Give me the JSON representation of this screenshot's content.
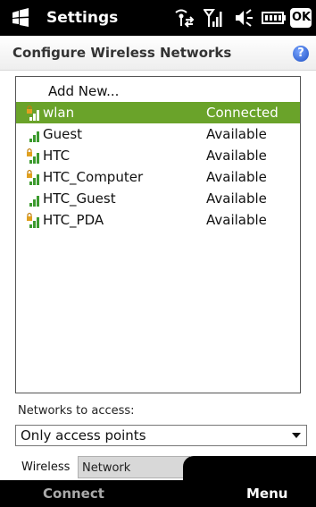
{
  "statusbar": {
    "title": "Settings",
    "ok_label": "OK",
    "icons": [
      "windows-flag-icon",
      "connectivity-icon",
      "signal-icon",
      "volume-icon",
      "battery-icon"
    ]
  },
  "header": {
    "title": "Configure Wireless Networks",
    "help_label": "?"
  },
  "network_list": {
    "add_new_label": "Add New...",
    "selected_color": "#6aa32a",
    "items": [
      {
        "name": "wlan",
        "status": "Connected",
        "secured": true,
        "selected": true
      },
      {
        "name": "Guest",
        "status": "Available",
        "secured": false,
        "selected": false
      },
      {
        "name": "HTC",
        "status": "Available",
        "secured": true,
        "selected": false
      },
      {
        "name": "HTC_Computer",
        "status": "Available",
        "secured": true,
        "selected": false
      },
      {
        "name": "HTC_Guest",
        "status": "Available",
        "secured": false,
        "selected": false
      },
      {
        "name": "HTC_PDA",
        "status": "Available",
        "secured": true,
        "selected": false
      }
    ]
  },
  "networks_to_access": {
    "label": "Networks to access:",
    "value": "Only access points"
  },
  "tabs": [
    {
      "label": "Wireless",
      "active": true
    },
    {
      "label": "Network Adapters",
      "active": false
    }
  ],
  "softkeys": {
    "left": "Connect",
    "right": "Menu"
  }
}
